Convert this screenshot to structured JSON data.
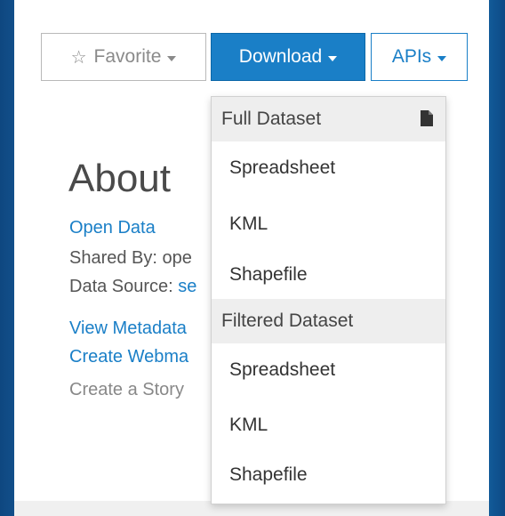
{
  "toolbar": {
    "favorite_label": "Favorite",
    "download_label": "Download",
    "apis_label": "APIs"
  },
  "about": {
    "title": "About",
    "open_data": "Open Data",
    "shared_by": "Shared By: ope",
    "data_source_label": "Data Source: ",
    "data_source_value": "se",
    "view_metadata": "View Metadata",
    "create_webmap": "Create Webma",
    "create_story": "Create a Story"
  },
  "dropdown": {
    "full_header": "Full Dataset",
    "full_items": [
      "Spreadsheet",
      "KML",
      "Shapefile"
    ],
    "filtered_header": "Filtered Dataset",
    "filtered_items": [
      "Spreadsheet",
      "KML",
      "Shapefile"
    ]
  },
  "colors": {
    "accent": "#1a7fc7",
    "background": "#0f4c84"
  },
  "icons": {
    "favorite": "star-icon",
    "header": "file-icon"
  }
}
